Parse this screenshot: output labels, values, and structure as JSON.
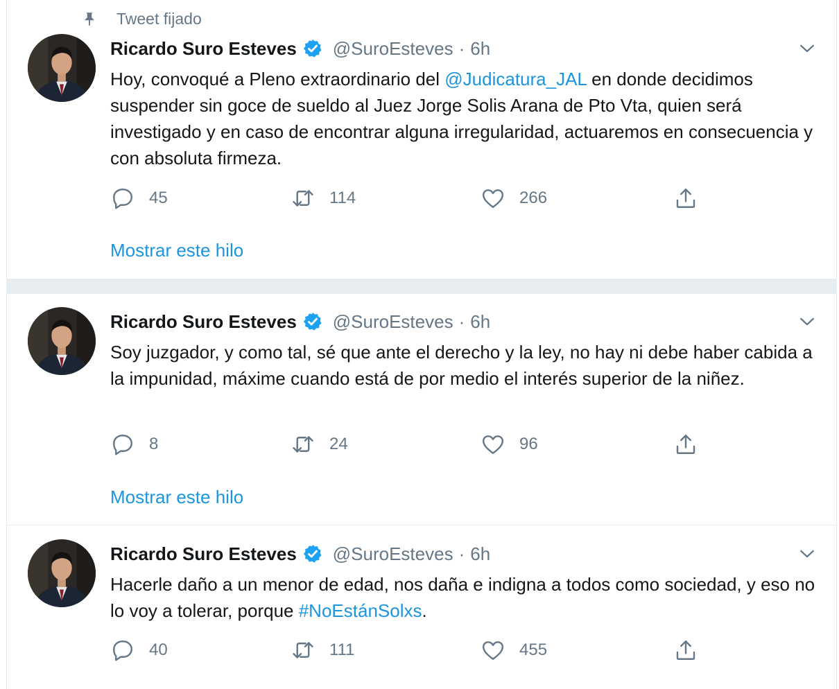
{
  "pinned_label": "Tweet fijado",
  "colors": {
    "link": "#1b95e0",
    "muted": "#657786",
    "text": "#14171a",
    "verified": "#1da1f2",
    "separator": "#e6ecf0"
  },
  "icons": {
    "pin": "pin-icon",
    "verified": "verified-badge-icon",
    "caret": "chevron-down-icon",
    "reply": "reply-icon",
    "retweet": "retweet-icon",
    "like": "heart-icon",
    "share": "share-icon"
  },
  "tweets": [
    {
      "name": "Ricardo Suro Esteves",
      "handle": "@SuroEsteves",
      "dot": "·",
      "time": "6h",
      "text_1": "Hoy, convoqué a Pleno extraordinario del ",
      "mention": "@Judicatura_JAL",
      "text_2": " en donde decidimos suspender sin goce de sueldo al Juez Jorge Solis Arana de Pto Vta, quien será investigado y en caso de encontrar alguna irregularidad, actuaremos en consecuencia y con absoluta firmeza.",
      "replies": "45",
      "retweets": "114",
      "likes": "266",
      "thread_link": "Mostrar este hilo"
    },
    {
      "name": "Ricardo Suro Esteves",
      "handle": "@SuroEsteves",
      "dot": "·",
      "time": "6h",
      "text": "Soy juzgador, y como tal, sé que ante el derecho y la ley, no hay ni debe haber cabida a la impunidad, máxime cuando está de por medio el interés superior de la niñez.",
      "replies": "8",
      "retweets": "24",
      "likes": "96",
      "thread_link": "Mostrar este hilo"
    },
    {
      "name": "Ricardo Suro Esteves",
      "handle": "@SuroEsteves",
      "dot": "·",
      "time": "6h",
      "text_1": "Hacerle daño a un menor de edad, nos daña e indigna a todos como sociedad, y eso no lo voy a tolerar, porque ",
      "hashtag": "#NoEstánSolxs",
      "text_2": ".",
      "replies": "40",
      "retweets": "111",
      "likes": "455"
    }
  ]
}
